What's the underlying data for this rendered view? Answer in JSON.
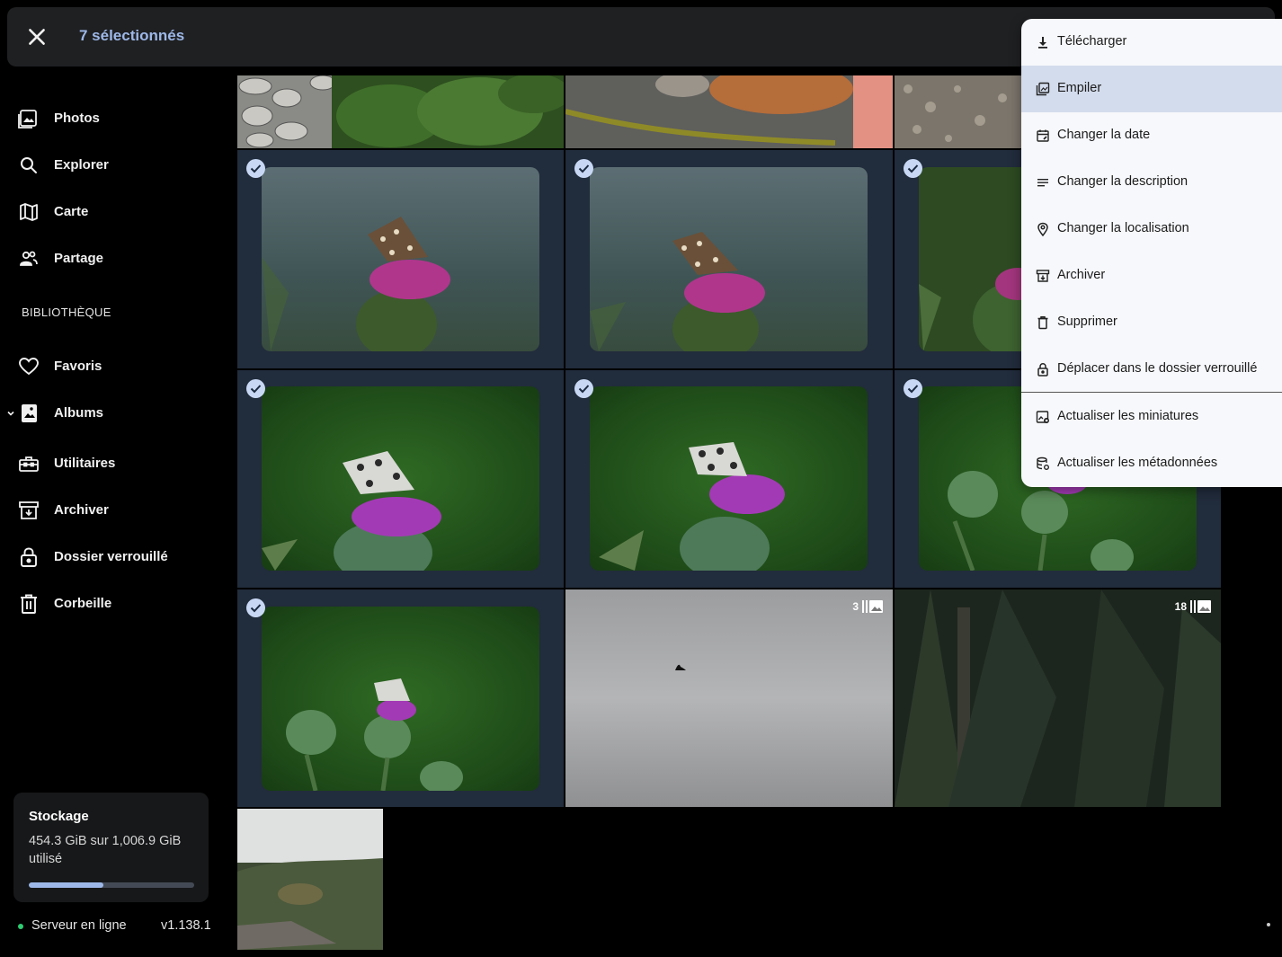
{
  "topbar": {
    "close_icon": "close-icon",
    "selected_label": "7 sélectionnés"
  },
  "sidebar": {
    "items": [
      {
        "label": "Photos",
        "icon": "photos-icon"
      },
      {
        "label": "Explorer",
        "icon": "search-icon"
      },
      {
        "label": "Carte",
        "icon": "map-icon"
      },
      {
        "label": "Partage",
        "icon": "sharing-icon"
      }
    ],
    "section_title": "BIBLIOTHÈQUE",
    "library": [
      {
        "label": "Favoris",
        "icon": "heart-icon"
      },
      {
        "label": "Albums",
        "icon": "albums-icon"
      },
      {
        "label": "Utilitaires",
        "icon": "toolbox-icon"
      },
      {
        "label": "Archiver",
        "icon": "archive-icon"
      },
      {
        "label": "Dossier verrouillé",
        "icon": "lock-icon"
      },
      {
        "label": "Corbeille",
        "icon": "trash-icon"
      }
    ],
    "storage": {
      "title": "Stockage",
      "usage": "454.3 GiB sur 1,006.9 GiB utilisé",
      "used_fraction": 0.451
    },
    "status": "Serveur en ligne",
    "version": "v1.138.1"
  },
  "grid": {
    "stack_badges": [
      "3",
      "18"
    ]
  },
  "menu": {
    "items": [
      {
        "label": "Télécharger",
        "icon": "download-icon"
      },
      {
        "label": "Empiler",
        "icon": "stack-icon",
        "highlighted": true
      },
      {
        "label": "Changer la date",
        "icon": "calendar-edit-icon"
      },
      {
        "label": "Changer la description",
        "icon": "text-lines-icon"
      },
      {
        "label": "Changer la localisation",
        "icon": "location-pin-icon"
      },
      {
        "label": "Archiver",
        "icon": "archive-icon"
      },
      {
        "label": "Supprimer",
        "icon": "trash-icon"
      },
      {
        "label": "Déplacer dans le dossier verrouillé",
        "icon": "lock-icon"
      },
      {
        "label": "Actualiser les miniatures",
        "icon": "refresh-thumbnails-icon"
      },
      {
        "label": "Actualiser les métadonnées",
        "icon": "refresh-metadata-icon"
      }
    ]
  },
  "colors": {
    "accent": "#9db8e8",
    "background": "#000000",
    "selected_tile": "#212c3c",
    "menu_background": "#f7f8fb",
    "menu_highlight": "#d3dcec",
    "online_dot": "#2ecc71"
  }
}
